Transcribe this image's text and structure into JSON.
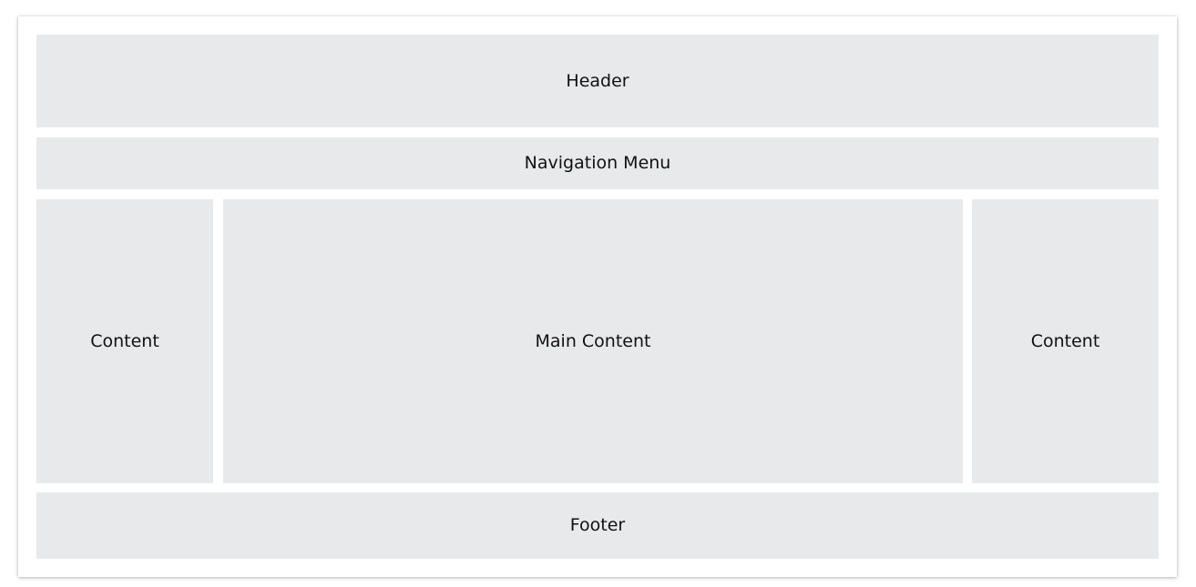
{
  "layout": {
    "header": {
      "label": "Header"
    },
    "navigation": {
      "label": "Navigation Menu"
    },
    "left_column": {
      "label": "Content"
    },
    "main": {
      "label": "Main Content"
    },
    "right_column": {
      "label": "Content"
    },
    "footer": {
      "label": "Footer"
    }
  },
  "colors": {
    "page_background": "#ffffff",
    "block_fill": "#e8e9ea",
    "text": "#111111"
  }
}
